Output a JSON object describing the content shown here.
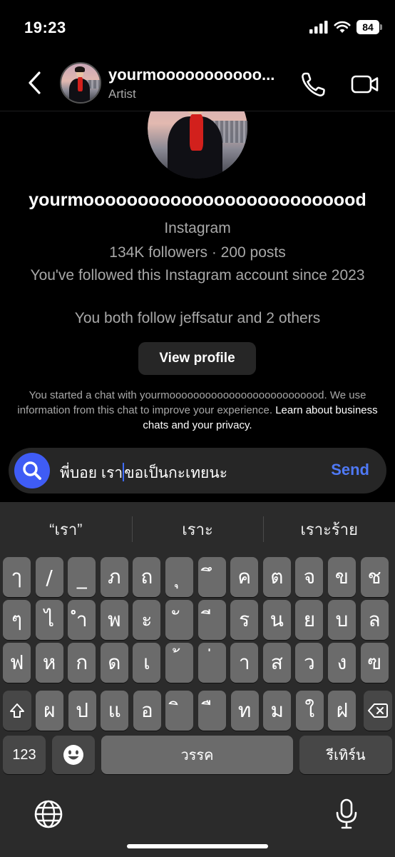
{
  "status_bar": {
    "time": "19:23",
    "battery": "84"
  },
  "header": {
    "name": "yourmooooooooooo...",
    "subtitle": "Artist"
  },
  "profile": {
    "name": "yourmoooooooooooooooooooooooood",
    "platform": "Instagram",
    "stats": "134K followers · 200 posts",
    "followed_since": "You've followed this Instagram account since 2023",
    "mutual": "You both follow jeffsatur and 2 others",
    "view_profile_label": "View profile"
  },
  "disclaimer": {
    "text": "You started a chat with yourmoooooooooooooooooooooooood. We use information from this chat to improve your experience.",
    "link": "Learn about business chats and your privacy."
  },
  "composer": {
    "text_before_caret": "พี่บอย เรา",
    "text_after_caret": "ขอเป็นกะเทยนะ",
    "send_label": "Send"
  },
  "keyboard": {
    "suggestions": [
      "“เรา”",
      "เราะ",
      "เราะร้าย"
    ],
    "rows": [
      [
        "ๅ",
        "/",
        "_",
        "ภ",
        "ถ",
        "ุ",
        "ึ",
        "ค",
        "ต",
        "จ",
        "ข",
        "ช"
      ],
      [
        "ๆ",
        "ไ",
        "ำ",
        "พ",
        "ะ",
        "ั",
        "ี",
        "ร",
        "น",
        "ย",
        "บ",
        "ล"
      ],
      [
        "ฟ",
        "ห",
        "ก",
        "ด",
        "เ",
        "้",
        "่",
        "า",
        "ส",
        "ว",
        "ง",
        "ฃ"
      ],
      [
        "ผ",
        "ป",
        "แ",
        "อ",
        "ิ",
        "ื",
        "ท",
        "ม",
        "ใ",
        "ฝ"
      ]
    ],
    "numbers_label": "123",
    "space_label": "วรรค",
    "return_label": "รีเทิร์น"
  },
  "colors": {
    "accent": "#3f5cf5",
    "send": "#4f79f6",
    "background": "#000000",
    "keyboard": "#2b2b2b"
  }
}
